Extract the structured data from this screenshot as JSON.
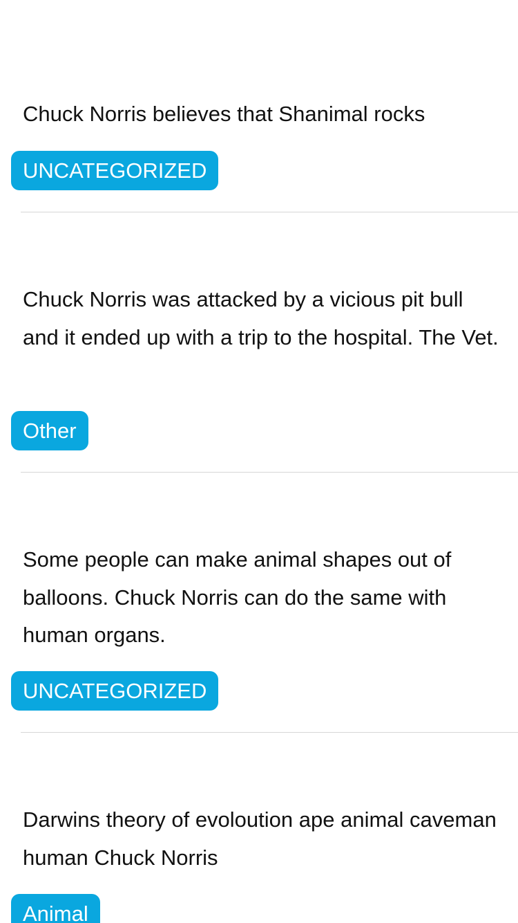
{
  "facts": [
    {
      "text": "Chuck Norris believes that Shanimal rocks",
      "category": "UNCATEGORIZED"
    },
    {
      "text": "Chuck Norris was attacked by a vicious pit bull and it ended up with a trip to the hospital. The Vet.",
      "category": "Other"
    },
    {
      "text": "Some people can make animal shapes out of balloons. Chuck Norris can do the same with human organs.",
      "category": "UNCATEGORIZED"
    },
    {
      "text": "Darwins theory of evoloution ape animal caveman human Chuck Norris",
      "category": "Animal"
    }
  ],
  "colors": {
    "badge_background": "#0aa7df",
    "badge_text": "#ffffff",
    "separator": "#d6d6d6",
    "body_text": "#111111"
  }
}
